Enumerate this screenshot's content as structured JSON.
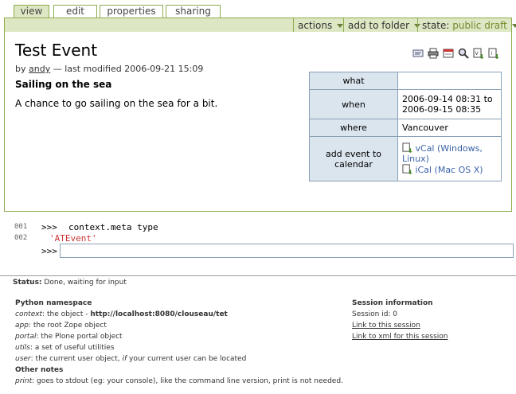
{
  "tabs": [
    {
      "label": "view",
      "active": true
    },
    {
      "label": "edit"
    },
    {
      "label": "properties"
    },
    {
      "label": "sharing"
    }
  ],
  "contentbar": {
    "actions": "actions",
    "add_to_folder": "add to folder",
    "state_label": "state:",
    "state_value": "public draft"
  },
  "document": {
    "title": "Test Event",
    "byline_prefix": "by",
    "author": "andy",
    "modified": "— last modified 2006-09-21 15:09",
    "description": "Sailing on the sea",
    "body": "A chance to go sailing on the sea for a bit.",
    "icons": [
      "send-to-icon",
      "print-icon",
      "fullscreen-icon",
      "search-icon",
      "vcal-icon",
      "ical-icon"
    ]
  },
  "details": {
    "what_label": "what",
    "what_value": "",
    "when_label": "when",
    "when_start": "2006-09-14 08:31 to",
    "when_end": "2006-09-15 08:35",
    "where_label": "where",
    "where_value": "Vancouver",
    "calendar_label": "add event to calendar",
    "vcal": "vCal (Windows, Linux)",
    "ical": "iCal (Mac OS X)"
  },
  "console": {
    "line1_no": "001",
    "line2_no": "002",
    "prompt": ">>>",
    "command": "context.meta type",
    "result": "'ATEvent'",
    "input_value": ""
  },
  "status": {
    "label": "Status:",
    "text": "Done, waiting for input"
  },
  "namespace": {
    "heading": "Python namespace",
    "context_label": "context",
    "context_text": ": the object -",
    "context_url": "http://localhost:8080/clouseau/tet",
    "app_label": "app",
    "app_text": ": the root Zope object",
    "portal_label": "portal",
    "portal_text": ": the Plone portal object",
    "utils_label": "utils",
    "utils_text": ": a set of useful utilities",
    "user_label": "user",
    "user_text1": ": the current user object,",
    "user_if": "if",
    "user_text2": "your current user can be located",
    "other_heading": "Other notes",
    "print_label": "print",
    "print_text": ": goes to stdout (eg: your console), like the command line version, print is not needed."
  },
  "session": {
    "heading": "Session information",
    "id_text": "Session id: 0",
    "link": "Link to this session",
    "xml_link": "Link to xml for this session"
  }
}
